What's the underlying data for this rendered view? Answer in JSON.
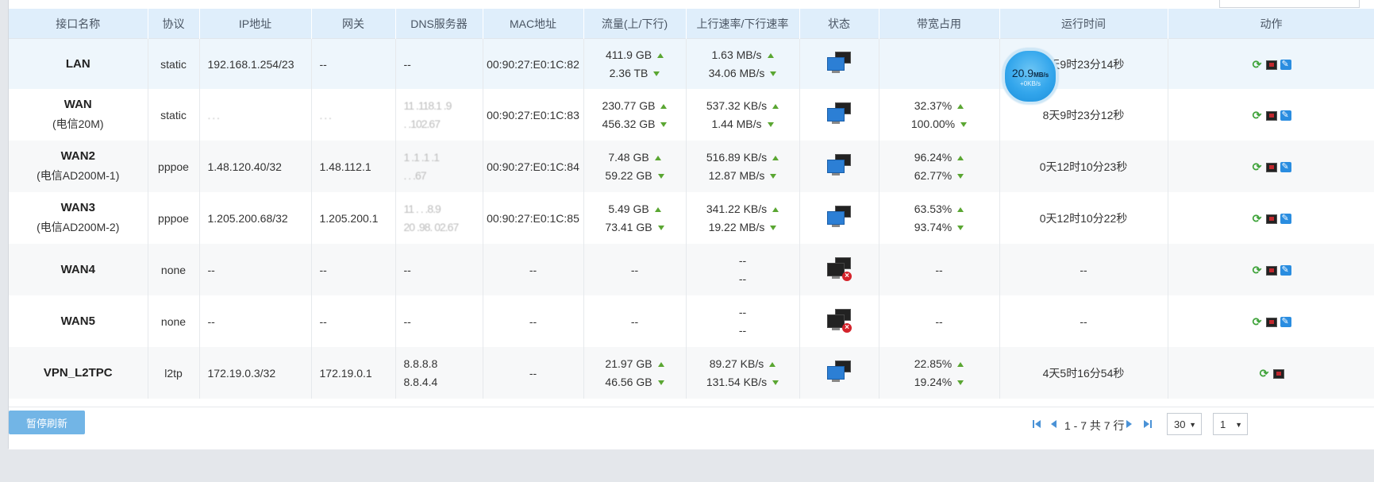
{
  "columns": [
    "接口名称",
    "协议",
    "IP地址",
    "网关",
    "DNS服务器",
    "MAC地址",
    "流量(上/下行)",
    "上行速率/下行速率",
    "状态",
    "带宽占用",
    "运行时间",
    "动作"
  ],
  "rows": [
    {
      "name": "LAN",
      "sub": "",
      "proto": "static",
      "ip": "192.168.1.254/23",
      "gateway": "--",
      "dns1": "--",
      "dns2": "",
      "mac": "00:90:27:E0:1C:82",
      "traffic_up": "411.9 GB",
      "traffic_down": "2.36 TB",
      "rate_up": "1.63 MB/s",
      "rate_down": "34.06 MB/s",
      "status": "connected",
      "bw_up": "",
      "bw_down": "",
      "uptime": "8天9时23分14秒",
      "edit": true
    },
    {
      "name": "WAN",
      "sub": "(电信20M)",
      "proto": "static",
      "ip": "  .  .  .  ",
      "gateway": "  .  .  .  ",
      "dns1": "11 .118.1 .9",
      "dns2": "  .  .102.67",
      "mac": "00:90:27:E0:1C:83",
      "traffic_up": "230.77 GB",
      "traffic_down": "456.32 GB",
      "rate_up": "537.32 KB/s",
      "rate_down": "1.44 MB/s",
      "status": "connected",
      "bw_up": "32.37%",
      "bw_down": "100.00%",
      "uptime": "8天9时23分12秒",
      "edit": true
    },
    {
      "name": "WAN2",
      "sub": "(电信AD200M-1)",
      "proto": "pppoe",
      "ip": "1.48.120.40/32",
      "gateway": "1.48.112.1",
      "dns1": "1 .1 .1 .1",
      "dns2": "  .  .  .67",
      "mac": "00:90:27:E0:1C:84",
      "traffic_up": "7.48 GB",
      "traffic_down": "59.22 GB",
      "rate_up": "516.89 KB/s",
      "rate_down": "12.87 MB/s",
      "status": "connected",
      "bw_up": "96.24%",
      "bw_down": "62.77%",
      "uptime": "0天12时10分23秒",
      "edit": true
    },
    {
      "name": "WAN3",
      "sub": "(电信AD200M-2)",
      "proto": "pppoe",
      "ip": "1.205.200.68/32",
      "gateway": "1.205.200.1",
      "dns1": "11 .  .  .8.9",
      "dns2": "20 .98. 02.67",
      "mac": "00:90:27:E0:1C:85",
      "traffic_up": "5.49 GB",
      "traffic_down": "73.41 GB",
      "rate_up": "341.22 KB/s",
      "rate_down": "19.22 MB/s",
      "status": "connected",
      "bw_up": "63.53%",
      "bw_down": "93.74%",
      "uptime": "0天12时10分22秒",
      "edit": true
    },
    {
      "name": "WAN4",
      "sub": "",
      "proto": "none",
      "ip": "--",
      "gateway": "--",
      "dns1": "--",
      "dns2": "",
      "mac": "--",
      "traffic_up": "--",
      "traffic_down": "",
      "rate_up": "--",
      "rate_down": "--",
      "status": "disconnected",
      "bw_up": "--",
      "bw_down": "",
      "uptime": "--",
      "edit": true
    },
    {
      "name": "WAN5",
      "sub": "",
      "proto": "none",
      "ip": "--",
      "gateway": "--",
      "dns1": "--",
      "dns2": "",
      "mac": "--",
      "traffic_up": "--",
      "traffic_down": "",
      "rate_up": "--",
      "rate_down": "--",
      "status": "disconnected",
      "bw_up": "--",
      "bw_down": "",
      "uptime": "--",
      "edit": true
    },
    {
      "name": "VPN_L2TPC",
      "sub": "",
      "proto": "l2tp",
      "ip": "172.19.0.3/32",
      "gateway": "172.19.0.1",
      "dns1": "8.8.8.8",
      "dns2": "8.8.4.4",
      "mac": "--",
      "traffic_up": "21.97 GB",
      "traffic_down": "46.56 GB",
      "rate_up": "89.27 KB/s",
      "rate_down": "131.54 KB/s",
      "status": "connected",
      "bw_up": "22.85%",
      "bw_down": "19.24%",
      "uptime": "4天5时16分54秒",
      "edit": false
    }
  ],
  "gauge": {
    "value": "20.9",
    "unit": "MB/s",
    "sub": "+0KB/s"
  },
  "footer": {
    "pause_label": "暂停刷新",
    "page_info": "1 - 7 共 7 行",
    "page_size": "30",
    "page_num": "1"
  },
  "colors": {
    "header_bg": "#dfeefb",
    "button": "#72b5e6",
    "arrow": "#5aa632",
    "accent": "#4a92d6"
  }
}
